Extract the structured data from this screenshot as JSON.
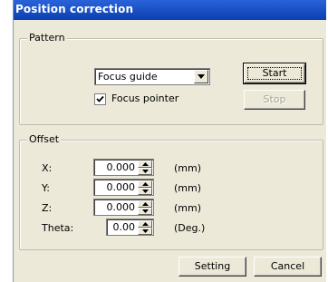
{
  "window": {
    "title": "Position correction"
  },
  "pattern": {
    "legend": "Pattern",
    "dropdown": {
      "value": "Focus guide"
    },
    "checkbox": {
      "label": "Focus pointer",
      "checked": true
    },
    "start_label": "Start",
    "stop_label": "Stop",
    "stop_enabled": false
  },
  "offset": {
    "legend": "Offset",
    "fields": [
      {
        "label": "X:",
        "value": "0.000",
        "unit": "(mm)"
      },
      {
        "label": "Y:",
        "value": "0.000",
        "unit": "(mm)"
      },
      {
        "label": "Z:",
        "value": "0.000",
        "unit": "(mm)"
      },
      {
        "label": "Theta:",
        "value": "0.00",
        "unit": "(Deg.)"
      }
    ]
  },
  "footer": {
    "setting_label": "Setting",
    "cancel_label": "Cancel"
  },
  "icons": {
    "dropdown": "chevron-down-icon",
    "spin_up": "arrow-up-icon",
    "spin_down": "arrow-down-icon",
    "check": "checkmark-icon"
  }
}
